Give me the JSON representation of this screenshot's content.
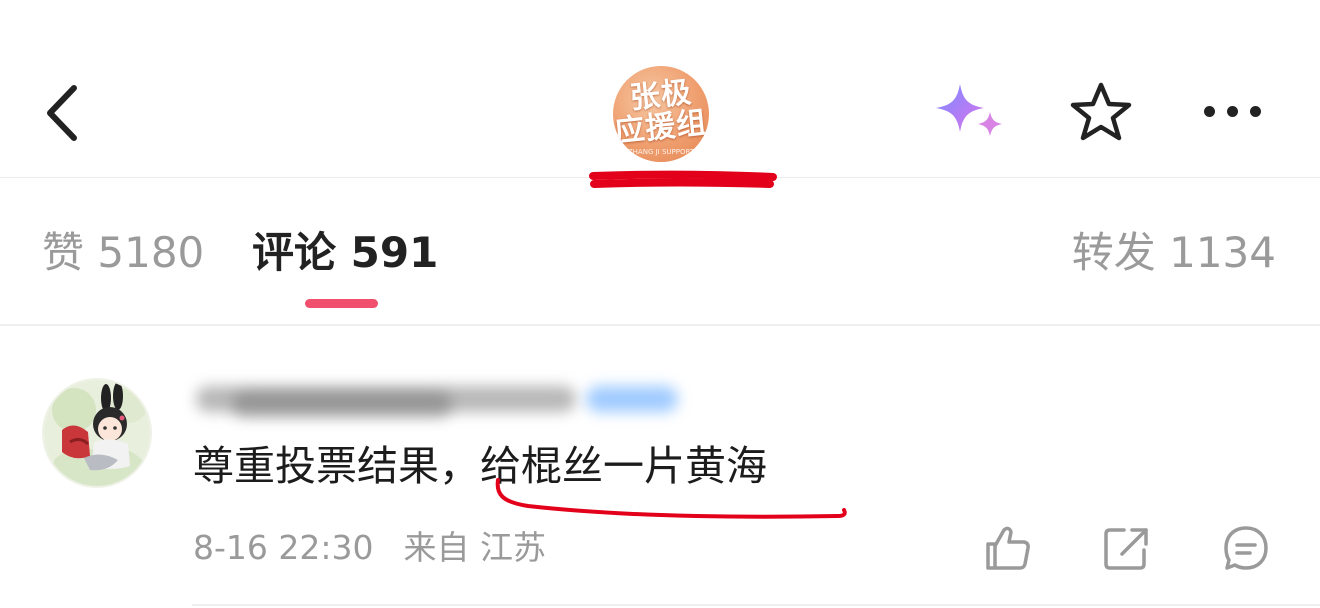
{
  "header": {
    "avatar": {
      "line1": "张极",
      "line2": "应援组",
      "line3": "ZHANG JI SUPPORT"
    }
  },
  "tabs": {
    "like": {
      "label": "赞",
      "count": "5180"
    },
    "comment": {
      "label": "评论",
      "count": "591"
    },
    "repost": {
      "label": "转发",
      "count": "1134"
    }
  },
  "comment": {
    "text_before": "尊重投票结果，",
    "text_highlight": "给棍丝一片黄海",
    "time": "8-16 22:30",
    "location": "来自 江苏"
  },
  "colors": {
    "tab_indicator": "#f0506e",
    "annotation_red": "#e2001a",
    "muted_text": "#9a9a9a"
  },
  "icons": [
    "back-chevron-icon",
    "sparkle-icon",
    "star-icon",
    "more-icon",
    "thumbs-up-icon",
    "share-icon",
    "reply-icon"
  ]
}
